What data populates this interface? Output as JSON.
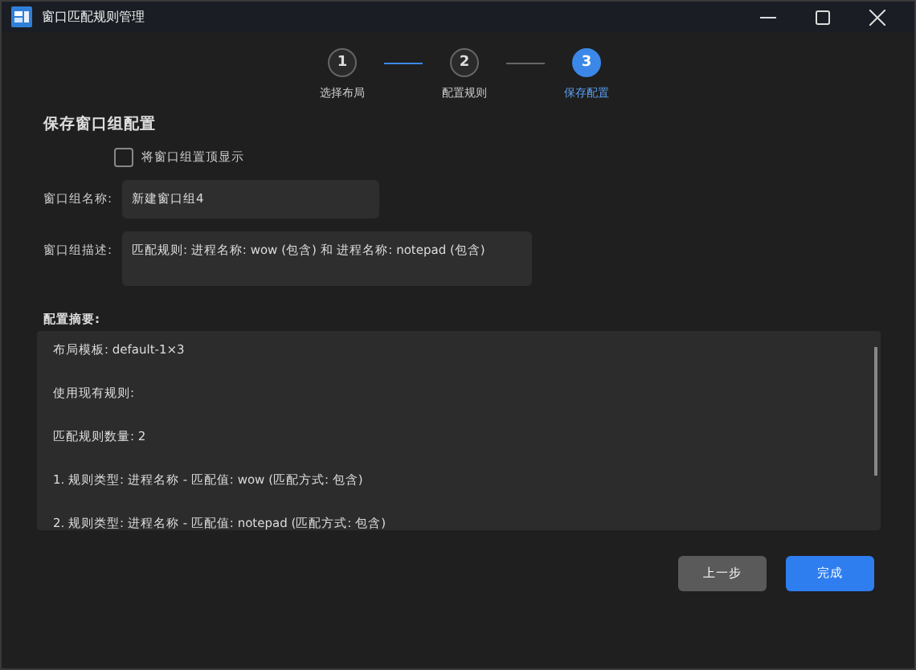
{
  "window": {
    "title": "窗口匹配规则管理"
  },
  "steps": [
    {
      "number": "1",
      "label": "选择布局",
      "selected": false
    },
    {
      "number": "2",
      "label": "配置规则",
      "selected": false
    },
    {
      "number": "3",
      "label": "保存配置",
      "selected": true
    }
  ],
  "connectors": [
    {
      "active": true
    },
    {
      "active": false
    }
  ],
  "form": {
    "heading": "保存窗口组配置",
    "pin_on_top": {
      "label": "将窗口组置顶显示",
      "checked": false
    },
    "name": {
      "label": "窗口组名称:",
      "value": "新建窗口组4"
    },
    "description": {
      "label": "窗口组描述:",
      "value": "匹配规则: 进程名称: wow (包含) 和 进程名称: notepad (包含)"
    }
  },
  "summary": {
    "label": "配置摘要:",
    "lines": [
      "布局模板: default-1×3",
      "使用现有规则:",
      "匹配规则数量: 2",
      "1. 规则类型: 进程名称 - 匹配值: wow (匹配方式: 包含)",
      "2. 规则类型: 进程名称 - 匹配值: notepad (匹配方式: 包含)"
    ]
  },
  "buttons": [
    {
      "label": "上一步",
      "kind": "secondary"
    },
    {
      "label": "完成",
      "kind": "primary"
    }
  ]
}
